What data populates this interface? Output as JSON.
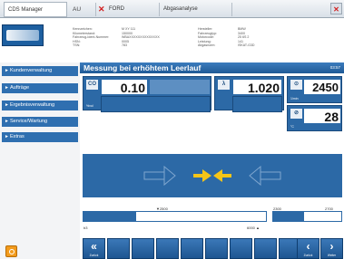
{
  "tabs": {
    "app": "CDS Manager",
    "country": "AU",
    "brand": "FORD",
    "module": "Abgasanalyse"
  },
  "info": {
    "col1": [
      "Kennzeichen:",
      "Kilometerstand:",
      "Fahrzeug-Ident-Nummer:",
      "HSN:",
      "TSN:"
    ],
    "col2": [
      "M XY 111",
      "150000",
      "WBAXXXXXXXXXXXXXX",
      "0005",
      "783"
    ],
    "col3": [
      "Hersteller:",
      "Fahrzeugtyp:",
      "Motorcode:",
      "Leistung:",
      "Abgasnorm:"
    ],
    "col4": [
      "BMW",
      "3400",
      "25 6S 2",
      "141",
      "ISKAT-G3D"
    ]
  },
  "sidebar": {
    "items": [
      {
        "label": "Kundenverwaltung"
      },
      {
        "label": "Aufträge"
      },
      {
        "label": "Ergebnisverwaltung"
      },
      {
        "label": "Service/Wartung"
      },
      {
        "label": "Extras"
      }
    ]
  },
  "main": {
    "title": "Messung bei erhöhtem Leerlauf",
    "title_right": "03:57",
    "co": {
      "icon": "CO",
      "value": "0.10",
      "unit": "%vol"
    },
    "lambda": {
      "icon": "λ",
      "value": "1.020"
    },
    "rpm": {
      "value": "2450",
      "unit": "1/min"
    },
    "temp": {
      "value": "28",
      "unit": "°C"
    },
    "band": {
      "scale1_label": "▼2500",
      "scale2_label": "2300",
      "scale3_label": "2700",
      "bar1_left": "b3",
      "bar1_right": "6000 ▲",
      "bar1_fill": 0.29,
      "bar2_fill": 0.45
    }
  },
  "toolbar": {
    "back_label": "Zurück",
    "prev_label": "Zurück",
    "next_label": "Weiter",
    "back_glyph": "«",
    "prev_glyph": "‹",
    "next_glyph": "›"
  },
  "colors": {
    "accent": "#2c69a6",
    "arrows": "#f5c518",
    "close": "#d21f1f"
  }
}
